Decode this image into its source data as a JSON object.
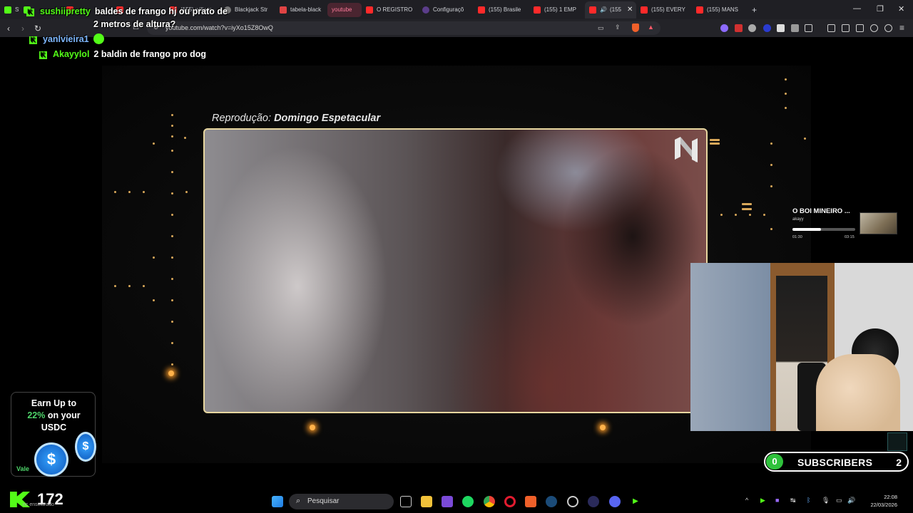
{
  "browser": {
    "tabs": [
      {
        "label": "St",
        "color": "#53fc18"
      },
      {
        "label": "",
        "color": "#53fc18"
      },
      {
        "label": "",
        "color": "#ff2a2a"
      },
      {
        "label": "",
        "color": "#ff2a2a"
      },
      {
        "label": "(155) will we",
        "color": "#ff2a2a"
      },
      {
        "label": "Blackjack Str",
        "color": "#aaaaaa"
      },
      {
        "label": "tabela-black",
        "color": "#e04444"
      },
      {
        "label": "youtube",
        "color": "#7a2d3a"
      },
      {
        "label": "O REGISTRO",
        "color": "#ff2a2a"
      },
      {
        "label": "Configuraçõ",
        "color": "#5b3d8a"
      },
      {
        "label": "(155) Brasile",
        "color": "#ff2a2a"
      },
      {
        "label": "(155) 1 EMP",
        "color": "#ff2a2a"
      },
      {
        "label": "(155",
        "color": "#ff2a2a"
      },
      {
        "label": "(155) EVERY",
        "color": "#ff2a2a"
      },
      {
        "label": "(155) MANS",
        "color": "#ff2a2a"
      }
    ],
    "new_tab_symbol": "+",
    "close_tab_symbol": "✕",
    "window_controls": {
      "minimize": "—",
      "restore": "❐",
      "close": "✕"
    },
    "url": "youtube.com/watch?v=iyXo15Z8OwQ"
  },
  "chat": [
    {
      "user": "sushiipretty",
      "message": "baldes de frango hj ou prato de",
      "message_cont": "2 metros de altura?"
    },
    {
      "user": "yanlvieira1",
      "message": ""
    },
    {
      "user": "Akayylol",
      "message": "2 baldin de frango pro dog"
    }
  ],
  "video": {
    "caption_prefix": "Reprodução:",
    "caption_program": "Domingo Espetacular"
  },
  "music": {
    "title": "O BOI MINEIRO ...",
    "artist": "akayy",
    "elapsed": "01:30",
    "total": "03:15",
    "progress": 0.46
  },
  "subscribers": {
    "left_count": "0",
    "label": "SUBSCRIBERS",
    "right_count": "2",
    "accent": "#2fc23c"
  },
  "ad": {
    "line1": "Earn Up to",
    "line2_accent": "22%",
    "line2_rest": " on your",
    "line3": "USDC",
    "coin_symbol": "$",
    "footer": "Vale"
  },
  "kick": {
    "viewer_count": "172",
    "subtitle": "nc ensolarado",
    "brand_color": "#53fc18"
  },
  "taskbar": {
    "search_placeholder": "Pesquisar",
    "time": "22:08",
    "date": "22/03/2026"
  }
}
